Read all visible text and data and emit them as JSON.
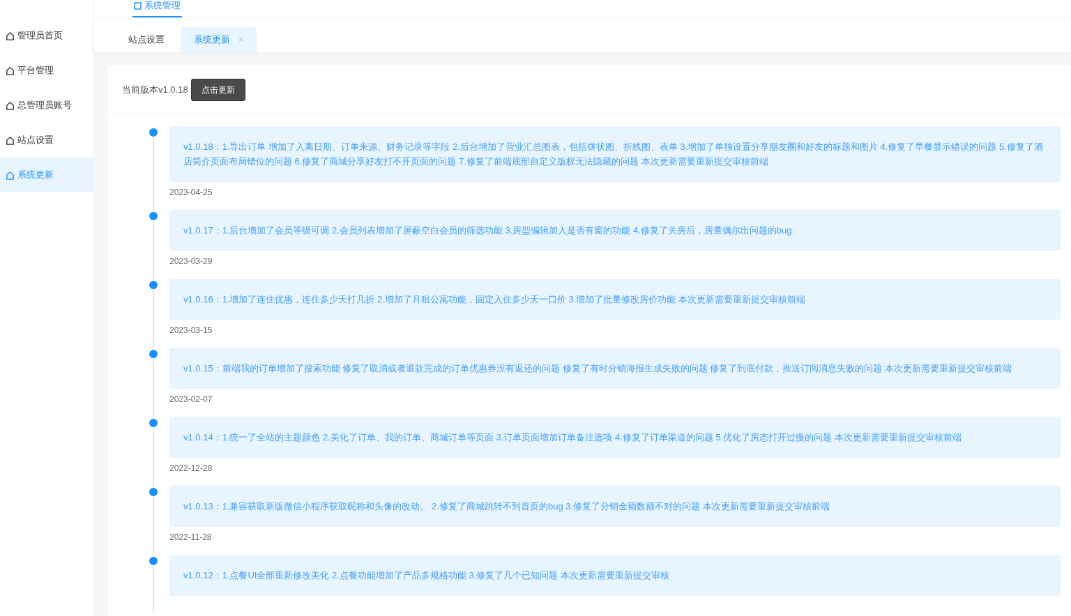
{
  "top_nav": {
    "items": [
      {
        "label": "系统管理",
        "selected": true
      }
    ]
  },
  "sidebar": {
    "items": [
      {
        "label": "管理员首页",
        "selected": false
      },
      {
        "label": "平台管理",
        "selected": false
      },
      {
        "label": "总管理员账号",
        "selected": false
      },
      {
        "label": "站点设置",
        "selected": false
      },
      {
        "label": "系统更新",
        "selected": true
      }
    ]
  },
  "tabs": [
    {
      "label": "站点设置",
      "selected": false
    },
    {
      "label": "系统更新",
      "selected": true,
      "close": "×"
    }
  ],
  "version_bar": {
    "label": "当前版本v1.0.18",
    "button": "点击更新"
  },
  "timeline": [
    {
      "text": "v1.0.18：1.导出订单 增加了入离日期、订单来源、财务记录等字段 2.后台增加了营业汇总图表，包括饼状图、折线图、表单 3.增加了单独设置分享朋友圈和好友的标题和图片 4.修复了早餐显示错误的问题 5.修复了酒店简介页面布局错位的问题 6.修复了商城分享好友打不开页面的问题 7.修复了前端底部自定义版权无法隐藏的问题 本次更新需要重新提交审核前端",
      "date": "2023-04-25"
    },
    {
      "text": "v1.0.17：1.后台增加了会员等级可调 2.会员列表增加了屏蔽空白会员的筛选功能 3.房型编辑加入是否有窗的功能 4.修复了关房后，房量偶尔出问题的bug",
      "date": "2023-03-29"
    },
    {
      "text": "v1.0.16：1.增加了连住优惠，连住多少天打几折 2.增加了月租公寓功能，固定入住多少天一口价 3.增加了批量修改房价功能 本次更新需要重新提交审核前端",
      "date": "2023-03-15"
    },
    {
      "text": "v1.0.15：前端我的订单增加了搜索功能 修复了取消或者退款完成的订单优惠券没有返还的问题 修复了有时分销海报生成失败的问题 修复了到底付款，推送订阅消息失败的问题 本次更新需要重新提交审核前端",
      "date": "2023-02-07"
    },
    {
      "text": "v1.0.14：1.统一了全站的主题颜色 2.美化了订单、我的订单、商城订单等页面 3.订单页面增加订单备注选项 4.修复了订单渠道的问题 5.优化了房态打开过慢的问题 本次更新需要重新提交审核前端",
      "date": "2022-12-28"
    },
    {
      "text": "v1.0.13：1.兼容获取新版微信小程序获取昵称和头像的改动。 2.修复了商城跳转不到首页的bug 3.修复了分销金额数额不对的问题 本次更新需要重新提交审核前端",
      "date": "2022-11-28"
    },
    {
      "text": "v1.0.12：1.点餐UI全部重新修改美化 2.点餐功能增加了产品多规格功能 3.修复了几个已知问题 本次更新需要重新提交审核"
    }
  ]
}
